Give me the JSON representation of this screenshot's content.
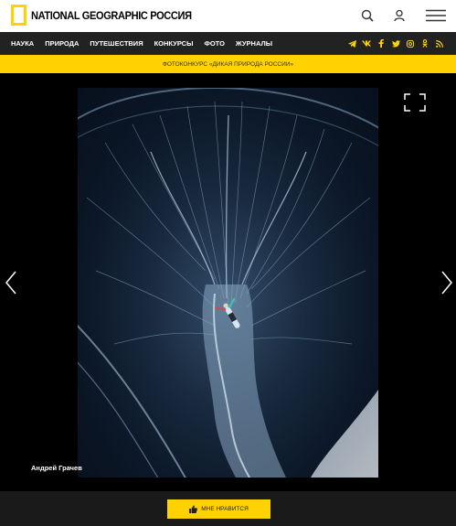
{
  "header": {
    "logo_text": "NATIONAL GEOGRAPHIC РОССИЯ",
    "search_icon": "search-icon",
    "user_icon": "user-icon",
    "menu_icon": "hamburger-menu-icon"
  },
  "nav": {
    "items": [
      "НАУКА",
      "ПРИРОДА",
      "ПУТЕШЕСТВИЯ",
      "КОНКУРСЫ",
      "ФОТО",
      "ЖУРНАЛЫ"
    ],
    "social": [
      "telegram-icon",
      "vk-icon",
      "facebook-icon",
      "twitter-icon",
      "instagram-icon",
      "odnoklassniki-icon",
      "rss-icon"
    ]
  },
  "promo": {
    "text": "ФОТОКОНКУРС «ДИКАЯ ПРИРОДА РОССИИ»"
  },
  "photo": {
    "credit": "Андрей Грачев"
  },
  "footer": {
    "like_label": "МНЕ НРАВИТСЯ"
  },
  "colors": {
    "accent": "#ffd200",
    "nav_bg": "#222222",
    "stage_bg": "#000000"
  }
}
